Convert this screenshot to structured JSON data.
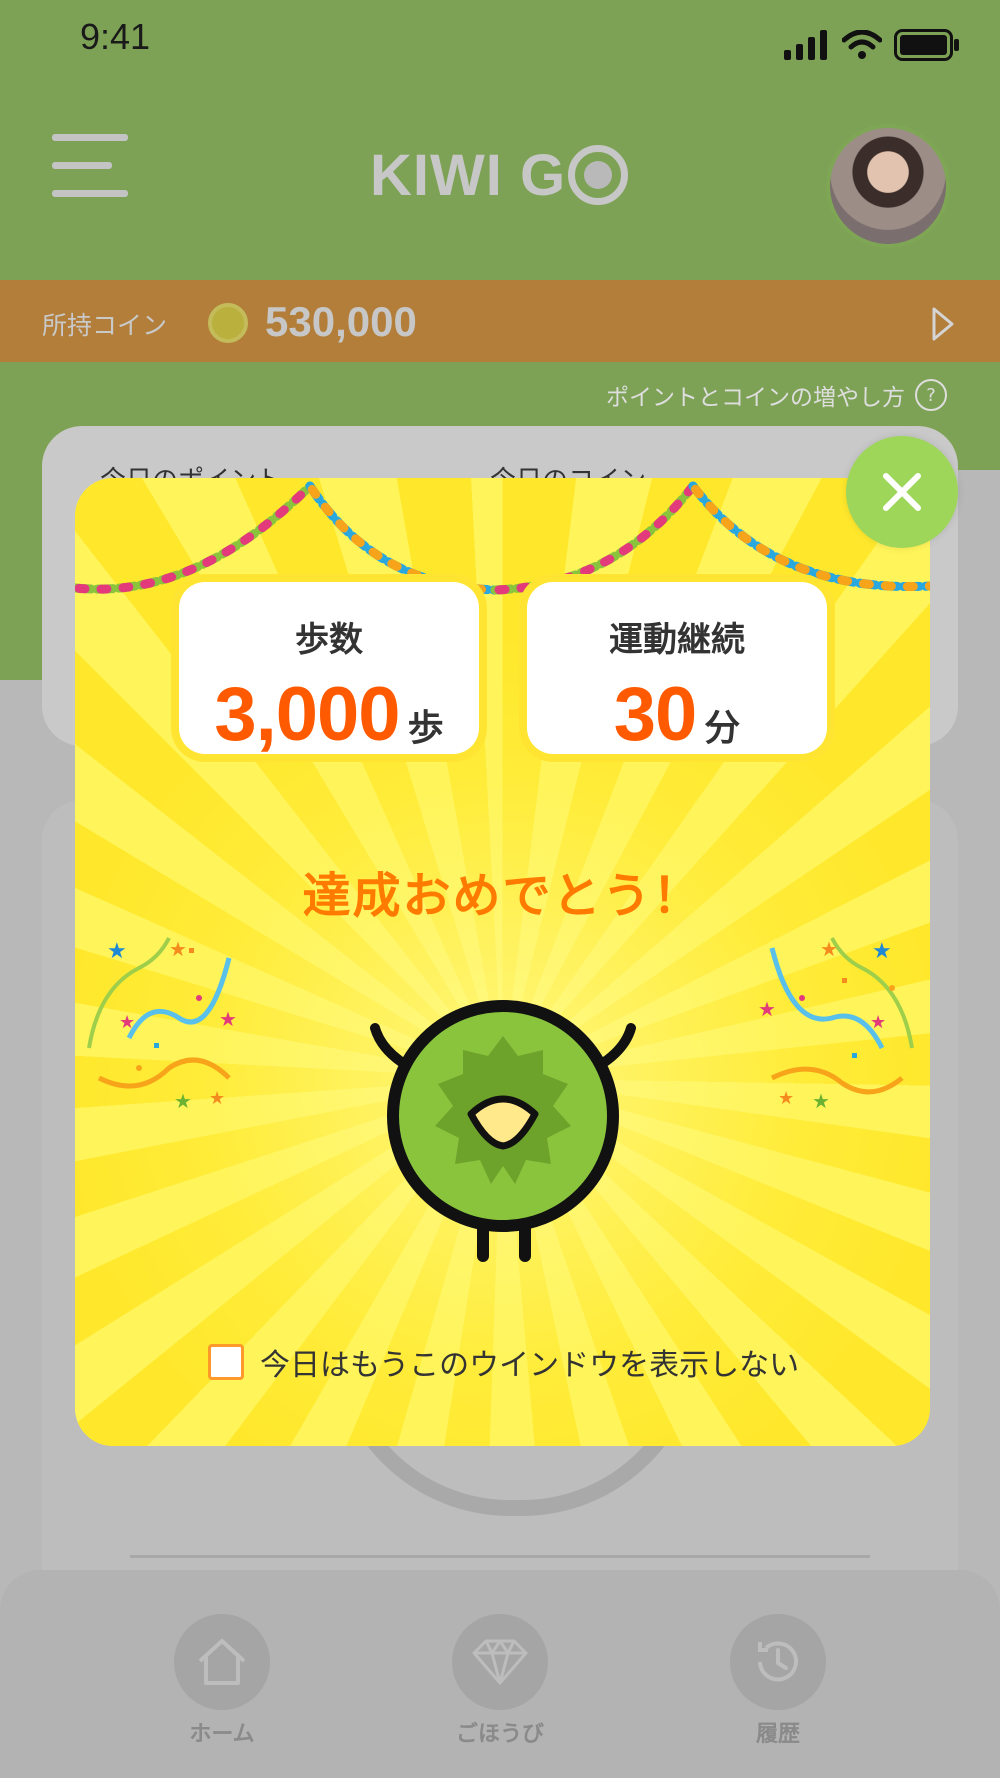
{
  "status_bar": {
    "time": "9:41"
  },
  "header": {
    "logo_text": "KIWI G",
    "logo_o": "O"
  },
  "coin_bar": {
    "label": "所持コイン",
    "value": "530,000"
  },
  "howto_link": {
    "label": "ポイントとコインの増やし方",
    "help_icon": "?"
  },
  "cards": {
    "points_label": "今日のポイント",
    "coins_label": "今日のコイン"
  },
  "modal": {
    "stats": [
      {
        "title": "歩数",
        "value": "3,000",
        "unit": "歩"
      },
      {
        "title": "運動継続",
        "value": "30",
        "unit": "分"
      }
    ],
    "congrats": "達成おめでとう！",
    "dont_show_label": "今日はもうこのウインドウを表示しない"
  },
  "bottom_nav": {
    "items": [
      {
        "label": "ホーム",
        "icon": "home-icon"
      },
      {
        "label": "ごほうび",
        "icon": "diamond-icon"
      },
      {
        "label": "履歴",
        "icon": "history-icon"
      }
    ]
  },
  "colors": {
    "header_green": "#7da255",
    "coin_bar": "#b27e3a",
    "modal_yellow": "#fff23c",
    "accent_orange": "#ff5a00",
    "close_green": "#9ed65a"
  }
}
